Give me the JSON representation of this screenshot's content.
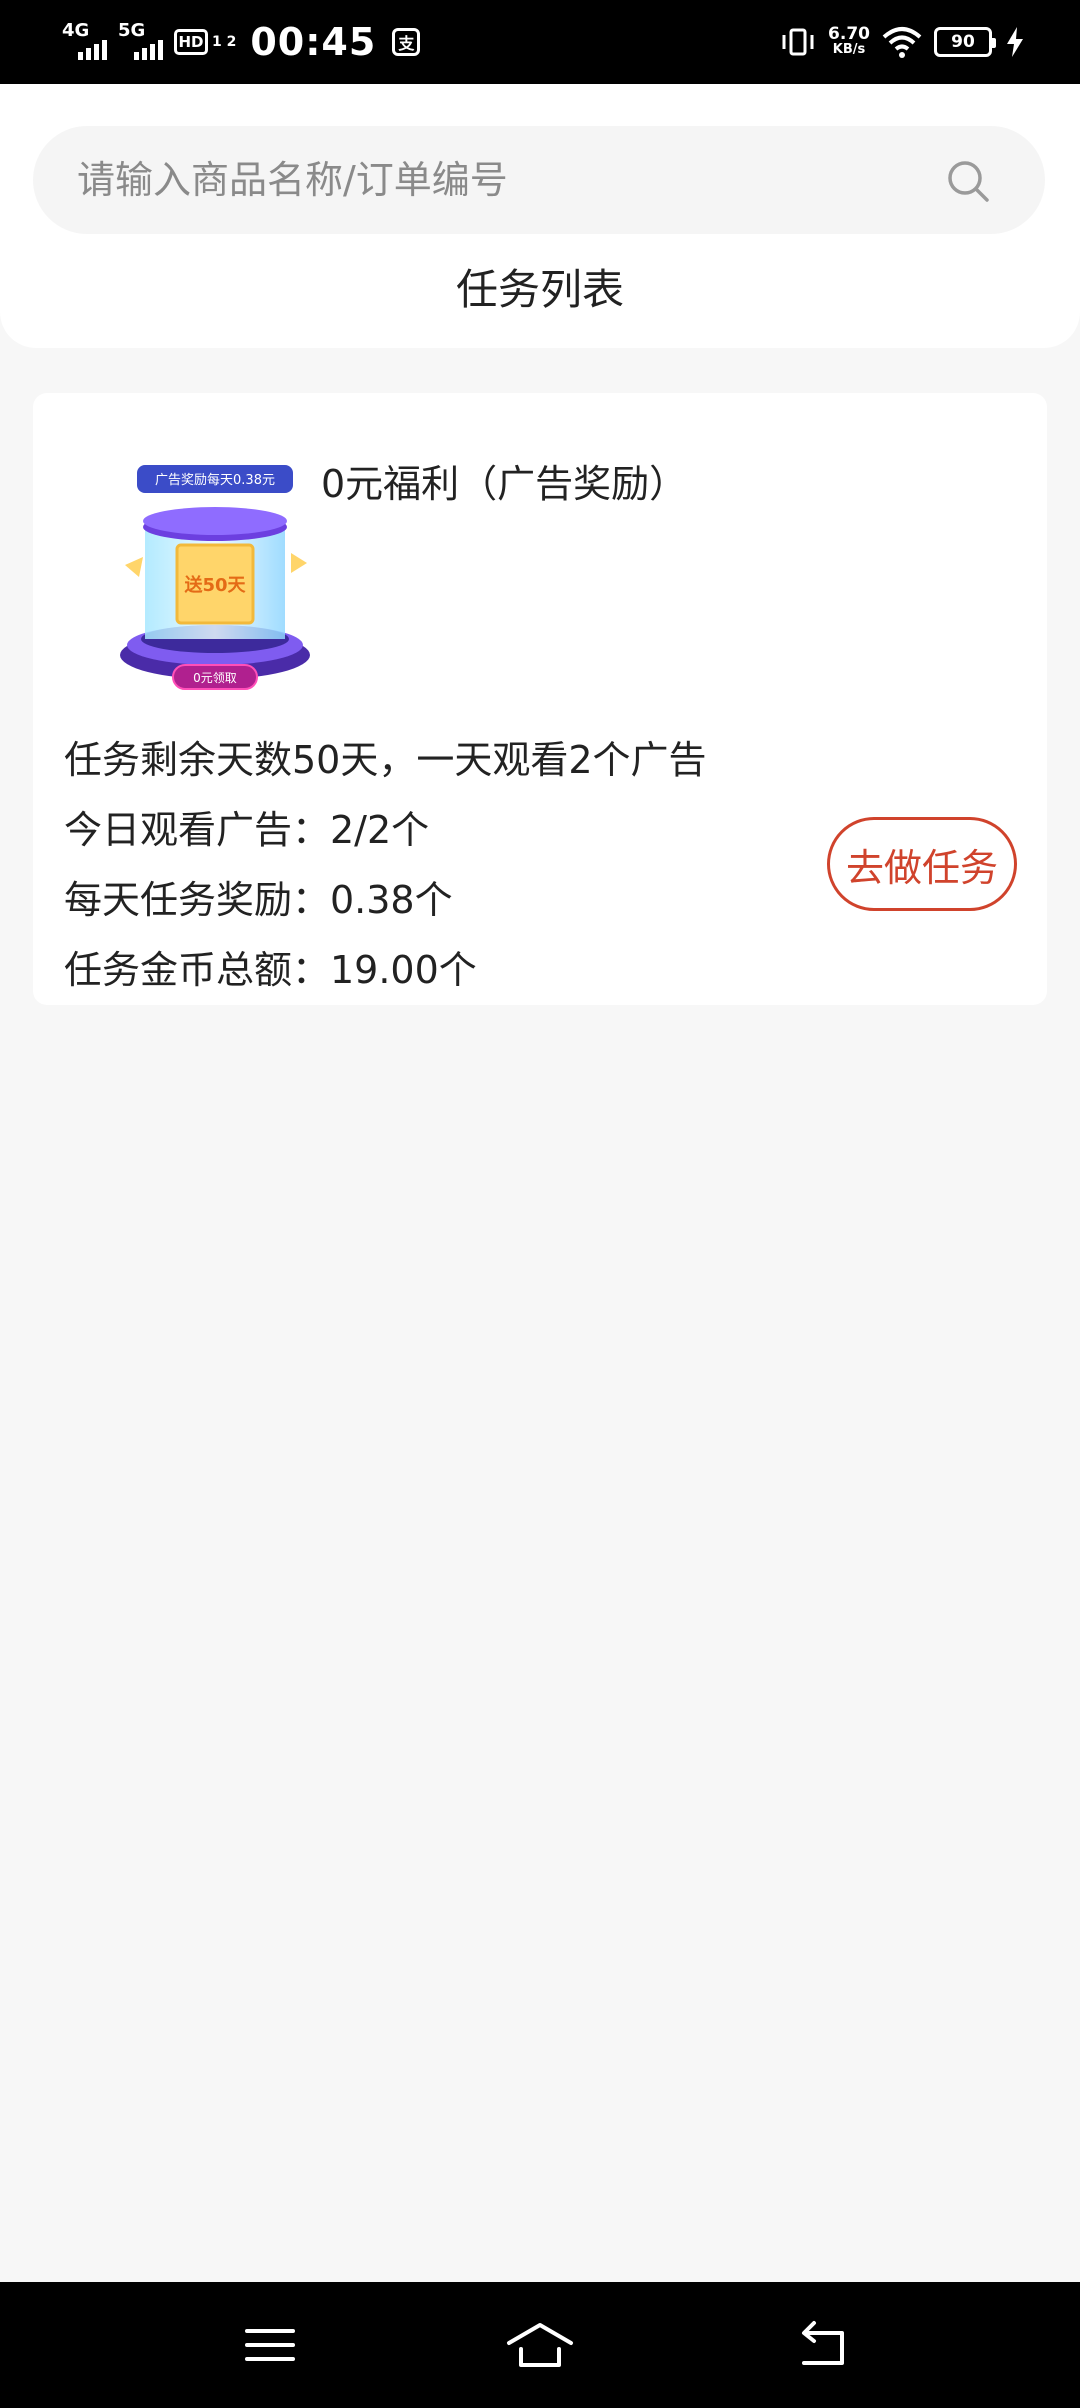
{
  "status_bar": {
    "net1": "4G",
    "net2": "5G",
    "hd": "HD",
    "hd_sub": "1 2",
    "time": "00:45",
    "app_icon": "支",
    "speed_value": "6.70",
    "speed_unit": "KB/s",
    "battery": "90"
  },
  "search": {
    "placeholder": "请输入商品名称/订单编号",
    "value": ""
  },
  "header": {
    "tab_title": "任务列表"
  },
  "task": {
    "title": "0元福利（广告奖励）",
    "image": {
      "banner_text": "广告奖励每天0.38元",
      "center_text": "送50天",
      "bottom_text": "0元领取"
    },
    "info": [
      "任务剩余天数50天，一天观看2个广告",
      "今日观看广告：2/2个",
      "每天任务奖励：0.38个",
      "任务金币总额：19.00个"
    ],
    "button_label": "去做任务",
    "button_color": "#d0432c"
  },
  "nav": {
    "icons": [
      "menu-icon",
      "home-icon",
      "back-icon"
    ]
  }
}
